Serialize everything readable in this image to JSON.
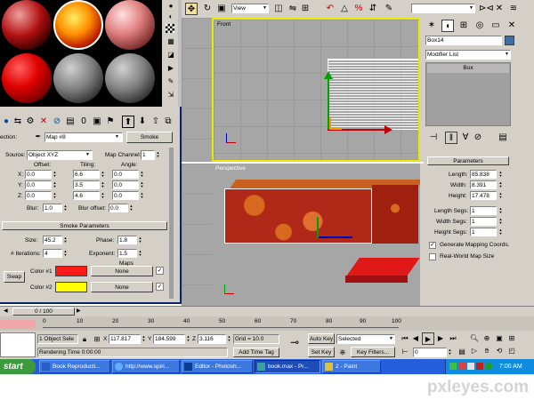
{
  "toolbar": {
    "view_dropdown": "View"
  },
  "viewports": {
    "front_label": "Front",
    "perspective_label": "Perspective"
  },
  "material_editor": {
    "reflection_label": "ection:",
    "map_name": "Map #8",
    "map_type_button": "Smoke",
    "coordinates": {
      "source_label": "Source:",
      "source_value": "Object XYZ",
      "map_channel_label": "Map Channel:",
      "map_channel_value": "1",
      "offset_header": "Offset:",
      "tiling_header": "Tiling:",
      "angle_header": "Angle:",
      "rows": [
        {
          "axis": "X:",
          "offset": "0.0",
          "tiling": "6.6",
          "angle": "0.0"
        },
        {
          "axis": "Y:",
          "offset": "0.0",
          "tiling": "3.5",
          "angle": "0.0"
        },
        {
          "axis": "Z:",
          "offset": "0.0",
          "tiling": "4.6",
          "angle": "0.0"
        }
      ],
      "blur_label": "Blur:",
      "blur_value": "1.0",
      "blur_offset_label": "Blur offset:",
      "blur_offset_value": "0.0"
    },
    "smoke": {
      "header": "Smoke Parameters",
      "size_label": "Size:",
      "size_value": "45.2",
      "phase_label": "Phase:",
      "phase_value": "1.8",
      "iterations_label": "# Iterations:",
      "iterations_value": "4",
      "exponent_label": "Exponent:",
      "exponent_value": "1.5",
      "maps_label": "Maps",
      "swap_button": "Swap",
      "color1_label": "Color #1",
      "color1_map": "None",
      "color1_hex": "#ff1a1a",
      "color2_label": "Color #2",
      "color2_map": "None",
      "color2_hex": "#ffff00"
    }
  },
  "command_panel": {
    "object_name": "Box14",
    "modifier_list": "Modifier List",
    "stack_item": "Box",
    "parameters_header": "Parameters",
    "length_label": "Length:",
    "length_value": "85.838",
    "width_label": "Width:",
    "width_value": "8.391",
    "height_label": "Height:",
    "height_value": "17.478",
    "length_segs_label": "Length Segs:",
    "length_segs_value": "1",
    "width_segs_label": "Width Segs:",
    "width_segs_value": "1",
    "height_segs_label": "Height Segs:",
    "height_segs_value": "1",
    "gen_mapping_label": "Generate Mapping Coords.",
    "real_world_label": "Real-World Map Size"
  },
  "timeline": {
    "frame_counter": "0 / 100",
    "ticks": [
      "0",
      "10",
      "20",
      "30",
      "40",
      "50",
      "60",
      "70",
      "80",
      "90",
      "100"
    ]
  },
  "status": {
    "selection": "1 Object Sele",
    "x_label": "X",
    "x_value": "117.817",
    "y_label": "Y",
    "y_value": "184.599",
    "z_label": "Z",
    "z_value": "3.116",
    "grid": "Grid = 10.0",
    "rendering_time": "Rendering Time  0:00:00",
    "add_time_tag": "Add Time Tag",
    "auto_key": "Auto Key",
    "selected_dropdown": "Selected",
    "set_key": "Set Key",
    "key_filters": "Key Filters...",
    "frame_value": "0"
  },
  "taskbar": {
    "start": "start",
    "items": [
      "Book Reproducti...",
      "http://www.spiri...",
      "Editor - Photosh...",
      "book.max - Pr...",
      "2 - Paint"
    ],
    "clock": "7:00 AM"
  },
  "watermark": "pxleyes.com"
}
